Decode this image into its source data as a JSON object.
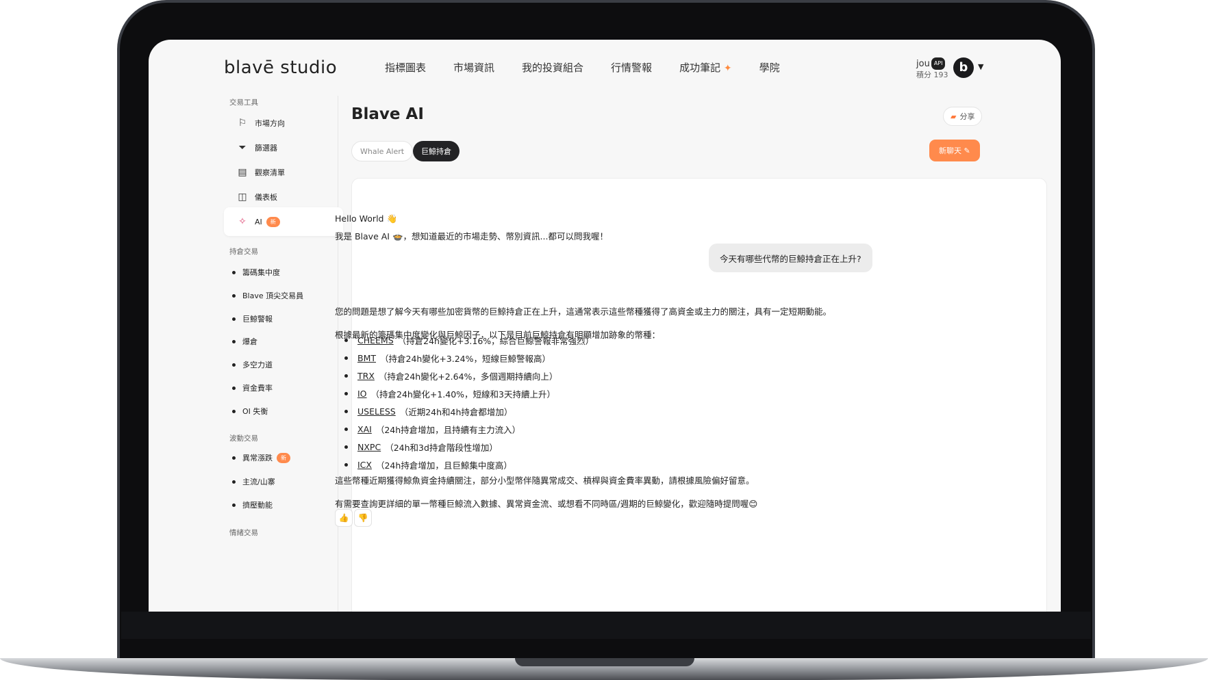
{
  "brand": {
    "logo": "blavē studio"
  },
  "nav": {
    "items": [
      "指標圖表",
      "市場資訊",
      "我的投資組合",
      "行情警報",
      "成功筆記",
      "學院"
    ]
  },
  "user": {
    "name": "jou",
    "api_badge": "API",
    "points": "積分 193",
    "avatar_letter": "b"
  },
  "sidebar": {
    "sections": [
      {
        "title": "交易工具"
      },
      {
        "title": "持倉交易"
      },
      {
        "title": "波動交易"
      },
      {
        "title": "情緒交易"
      }
    ],
    "tools": [
      {
        "label": "市場方向",
        "icon": "flag-icon"
      },
      {
        "label": "篩選器",
        "icon": "filter-icon"
      },
      {
        "label": "觀察清單",
        "icon": "list-icon"
      },
      {
        "label": "儀表板",
        "icon": "dashboard-icon"
      },
      {
        "label": "AI",
        "icon": "ai-icon",
        "badge": "新"
      }
    ],
    "position_items": [
      "籌碼集中度",
      "Blave 頂尖交易員",
      "巨鯨警報",
      "爆倉",
      "多空力道",
      "資金費率",
      "OI 失衡"
    ],
    "volatility_items": [
      {
        "label": "異常漲跌",
        "badge": "新"
      },
      {
        "label": "主流/山寨"
      },
      {
        "label": "擠壓動能"
      }
    ]
  },
  "main": {
    "title": "Blave AI",
    "share_label": "分享",
    "tabs": [
      "Whale Alert",
      "巨鯨持倉"
    ],
    "new_chat_label": "新聊天",
    "greeting": "Hello World 👋",
    "intro": "我是 Blave AI 🍲，想知道最近的市場走勢、幣別資訊...都可以問我喔！",
    "user_question": "今天有哪些代幣的巨鯨持倉正在上升?",
    "answer_p1": "您的問題是想了解今天有哪些加密貨幣的巨鯨持倉正在上升，這通常表示這些幣種獲得了高資金或主力的關注，具有一定短期動能。",
    "answer_p2": "根據最新的籌碼集中度變化與巨鯨因子，以下是目前巨鯨持倉有明顯增加跡象的幣種：",
    "coins": [
      {
        "symbol": "CHEEMS",
        "note": "（持倉24h變化+3.16%，綜合巨鯨警報非常強烈）"
      },
      {
        "symbol": "BMT",
        "note": "（持倉24h變化+3.24%，短線巨鯨警報高）"
      },
      {
        "symbol": "TRX",
        "note": "（持倉24h變化+2.64%，多個週期持續向上）"
      },
      {
        "symbol": "IO",
        "note": "（持倉24h變化+1.40%，短線和3天持續上升）"
      },
      {
        "symbol": "USELESS",
        "note": "（近期24h和4h持倉都增加）"
      },
      {
        "symbol": "XAI",
        "note": "（24h持倉增加，且持續有主力流入）"
      },
      {
        "symbol": "NXPC",
        "note": "（24h和3d持倉階段性增加）"
      },
      {
        "symbol": "ICX",
        "note": "（24h持倉增加，且巨鯨集中度高）"
      }
    ],
    "answer_p3": "這些幣種近期獲得鯨魚資金持續關注，部分小型幣伴隨異常成交、槓桿與資金費率異動，請根據風險偏好留意。",
    "answer_p4": "有需要查詢更詳細的單一幣種巨鯨流入數據、異常資金流、或想看不同時區/週期的巨鯨變化，歡迎隨時提問喔😊"
  }
}
